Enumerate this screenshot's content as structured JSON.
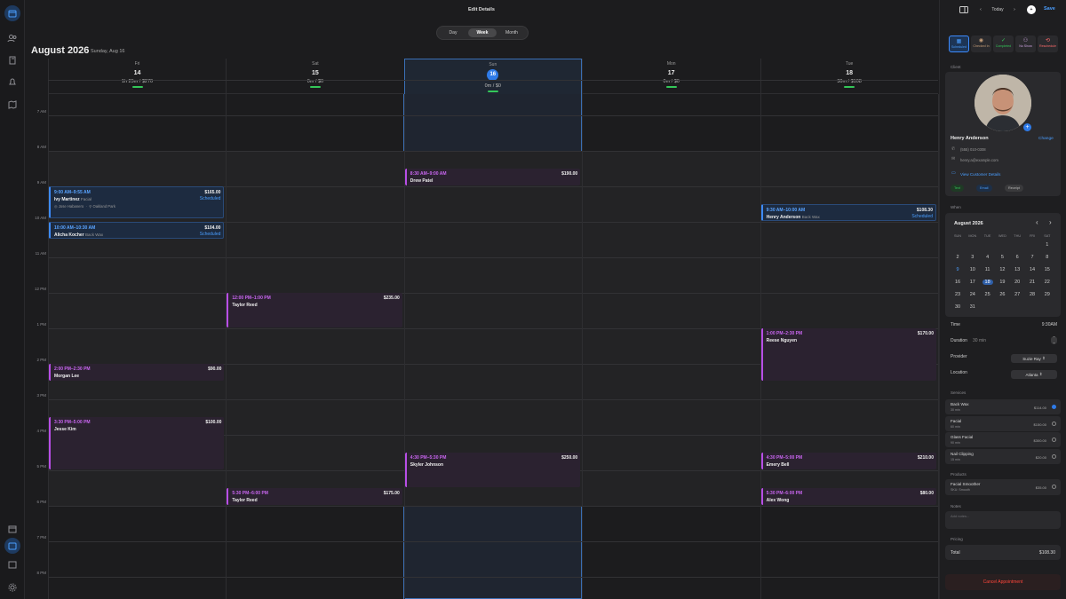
{
  "header": {
    "edit_title": "Edit Details"
  },
  "view_toggle": {
    "day": "Day",
    "week": "Week",
    "month": "Month",
    "selected": "Week"
  },
  "calendar": {
    "month_title": "August 2026",
    "date_subtitle": "Sunday, Aug 16",
    "days": [
      {
        "name": "Fri",
        "date": "14",
        "summary": "1h 25m / $270"
      },
      {
        "name": "Sat",
        "date": "15",
        "summary": "0m / $0"
      },
      {
        "name": "Sun",
        "date": "16",
        "summary": "0m / $0"
      },
      {
        "name": "Mon",
        "date": "17",
        "summary": "0m / $0"
      },
      {
        "name": "Tue",
        "date": "18",
        "summary": "30m / $108"
      }
    ],
    "hours": [
      "7 AM",
      "8 AM",
      "9 AM",
      "10 AM",
      "11 AM",
      "12 PM",
      "1 PM",
      "2 PM",
      "3 PM",
      "4 PM",
      "5 PM",
      "6 PM",
      "7 PM",
      "8 PM"
    ],
    "events": [
      {
        "day": 0,
        "start": 9.0,
        "end": 9.92,
        "time": "9:00 AM–9:55 AM",
        "name": "Ivy Martinez",
        "service": "Facial",
        "price": "$165.00",
        "status": "Scheduled",
        "color": "blue",
        "staff": "Jose Habanero",
        "location": "Oakland Park"
      },
      {
        "day": 0,
        "start": 10.0,
        "end": 10.5,
        "time": "10:00 AM–10:30 AM",
        "name": "Alicha Kocher",
        "service": "Back Wax",
        "price": "$104.00",
        "status": "Scheduled",
        "color": "blue"
      },
      {
        "day": 0,
        "start": 14.0,
        "end": 14.5,
        "time": "2:00 PM–2:30 PM",
        "name": "Morgan Lee",
        "price": "$90.00",
        "color": "purple"
      },
      {
        "day": 0,
        "start": 15.5,
        "end": 17.0,
        "time": "3:30 PM–5:00 PM",
        "name": "Jesse Kim",
        "price": "$100.00",
        "color": "purple"
      },
      {
        "day": 1,
        "start": 12.0,
        "end": 13.0,
        "time": "12:00 PM–1:00 PM",
        "name": "Taylor Reed",
        "price": "$235.00",
        "color": "purple"
      },
      {
        "day": 1,
        "start": 17.5,
        "end": 18.0,
        "time": "5:30 PM–6:00 PM",
        "name": "Taylor Reed",
        "price": "$175.00",
        "color": "purple"
      },
      {
        "day": 2,
        "start": 8.5,
        "end": 9.0,
        "time": "8:30 AM–9:00 AM",
        "name": "Drew Patel",
        "price": "$190.00",
        "color": "purple"
      },
      {
        "day": 2,
        "start": 16.5,
        "end": 17.5,
        "time": "4:30 PM–5:30 PM",
        "name": "Skyler Johnson",
        "price": "$250.00",
        "color": "purple"
      },
      {
        "day": 4,
        "start": 9.5,
        "end": 10.0,
        "time": "9:30 AM–10:00 AM",
        "name": "Henry Anderson",
        "service": "Back Wax",
        "price": "$108.30",
        "status": "Scheduled",
        "color": "blue"
      },
      {
        "day": 4,
        "start": 13.0,
        "end": 14.5,
        "time": "1:00 PM–2:30 PM",
        "name": "Reese Nguyen",
        "price": "$170.00",
        "color": "purple"
      },
      {
        "day": 4,
        "start": 16.5,
        "end": 17.0,
        "time": "4:30 PM–5:00 PM",
        "name": "Emery Bell",
        "price": "$210.00",
        "color": "purple"
      },
      {
        "day": 4,
        "start": 17.5,
        "end": 18.0,
        "time": "5:30 PM–6:00 PM",
        "name": "Alex Wong",
        "price": "$80.00",
        "color": "purple"
      }
    ]
  },
  "panel": {
    "today": "Today",
    "save": "Save",
    "statuses": [
      "Scheduled",
      "Checked In",
      "Completed",
      "No Show",
      "Reschedule"
    ],
    "client_section": "Client",
    "client_name": "Henry Anderson",
    "change": "Change",
    "phone": "(555) 010-0308",
    "email": "henry.a@example.com",
    "view_details": "View Customer Details",
    "actions": [
      "Text",
      "Email",
      "Receipt"
    ],
    "when_section": "When",
    "mini_month": "August 2026",
    "weekdays": [
      "SUN",
      "MON",
      "TUE",
      "WED",
      "THU",
      "FRI",
      "SAT"
    ],
    "mini_days": [
      "1",
      "2",
      "3",
      "4",
      "5",
      "6",
      "7",
      "8",
      "9",
      "10",
      "11",
      "12",
      "13",
      "14",
      "15",
      "16",
      "17",
      "18",
      "19",
      "20",
      "21",
      "22",
      "23",
      "24",
      "25",
      "26",
      "27",
      "28",
      "29",
      "30",
      "31"
    ],
    "time_label": "Time",
    "time_value": "9:30AM",
    "duration_label": "Duration",
    "duration_value": "30 min",
    "provider_label": "Provider",
    "provider_value": "Suzie Ray",
    "location_label": "Location",
    "location_value": "Atlanta",
    "services_section": "Services",
    "services": [
      {
        "name": "Back Wax",
        "dur": "30 min",
        "price": "$114.00",
        "selected": true
      },
      {
        "name": "Facial",
        "dur": "60 min",
        "price": "$150.00",
        "selected": false
      },
      {
        "name": "Glass Facial",
        "dur": "90 min",
        "price": "$300.00",
        "selected": false
      },
      {
        "name": "Nail Clipping",
        "dur": "15 min",
        "price": "$20.00",
        "selected": false
      }
    ],
    "products_section": "Products",
    "products": [
      {
        "name": "Facial Smoother",
        "sub": "SKU: Smooth",
        "price": "$35.00"
      }
    ],
    "notes_section": "Notes",
    "notes_placeholder": "Add notes...",
    "pricing_section": "Pricing",
    "total_label": "Total",
    "total_value": "$108.30",
    "cancel": "Cancel Appointment"
  },
  "colors": {
    "accent": "#2f7be8",
    "event_purple": "#b84ee6",
    "event_blue": "#3d8bfd",
    "cancel": "#ff453a",
    "green": "#34c759"
  }
}
